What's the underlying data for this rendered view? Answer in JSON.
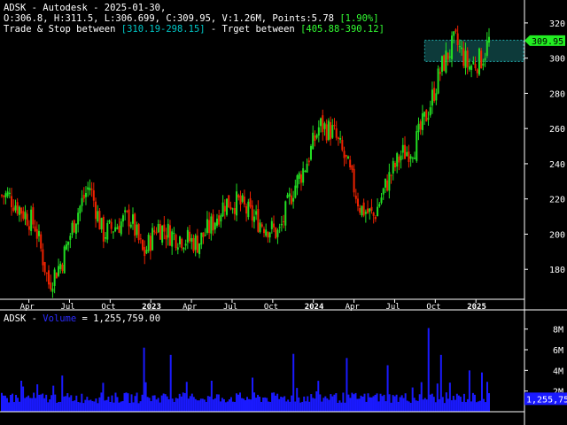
{
  "header": {
    "title": "ADSK - Autodesk - 2025-01-30,",
    "ohlc": "O:306.8, H:311.5, L:306.699, C:309.95, V:1.26M, Points:5.78",
    "change_pct": "[1.90%]",
    "line3_prefix": "Trade & Stop between ",
    "trade_stop_range": "[310.19-298.15]",
    "line3_mid": " - Trget between ",
    "target_range": "[405.88-390.12]"
  },
  "volume_header": {
    "symbol": "ADSK",
    "sep1": " - ",
    "label": "Volume",
    "sep2": " = ",
    "value": "1,255,759.00"
  },
  "colors": {
    "background": "#000000",
    "up_candle": "#22dd22",
    "down_candle": "#ee2200",
    "volume_bar": "#1a1aff",
    "zone_fill": "#0d3a3a",
    "zone_border": "#22aaaa",
    "price_tag": "#22ee22",
    "volume_tag": "#1a1aff",
    "axis": "#ffffff"
  },
  "chart_data": [
    {
      "type": "candlestick",
      "title": "ADSK - Autodesk - 2025-01-30",
      "y_ticks": [
        180,
        200,
        220,
        240,
        260,
        280,
        300,
        320
      ],
      "ylim": [
        163,
        328
      ],
      "x_ticks": [
        "Apr",
        "Jul",
        "Oct",
        "2023",
        "Apr",
        "Jul",
        "Oct",
        "2024",
        "Apr",
        "Jul",
        "Oct",
        "2025"
      ],
      "last_price_label": "309.95",
      "zone": {
        "low": 298.15,
        "high": 310.19
      },
      "approx_close_path": [
        {
          "t": "2022-02",
          "close": 222
        },
        {
          "t": "2022-04",
          "close": 205
        },
        {
          "t": "2022-05",
          "close": 172
        },
        {
          "t": "2022-06",
          "close": 185
        },
        {
          "t": "2022-07",
          "close": 210
        },
        {
          "t": "2022-08",
          "close": 228
        },
        {
          "t": "2022-09",
          "close": 200
        },
        {
          "t": "2022-10",
          "close": 205
        },
        {
          "t": "2022-11",
          "close": 210
        },
        {
          "t": "2022-12",
          "close": 188
        },
        {
          "t": "2023-01",
          "close": 205
        },
        {
          "t": "2023-02",
          "close": 200
        },
        {
          "t": "2023-04",
          "close": 195
        },
        {
          "t": "2023-05",
          "close": 205
        },
        {
          "t": "2023-06",
          "close": 218
        },
        {
          "t": "2023-07",
          "close": 218
        },
        {
          "t": "2023-08",
          "close": 210
        },
        {
          "t": "2023-09",
          "close": 205
        },
        {
          "t": "2023-10",
          "close": 200
        },
        {
          "t": "2023-11",
          "close": 225
        },
        {
          "t": "2023-12",
          "close": 240
        },
        {
          "t": "2024-01",
          "close": 262
        },
        {
          "t": "2024-02",
          "close": 258
        },
        {
          "t": "2024-03",
          "close": 240
        },
        {
          "t": "2024-04",
          "close": 215
        },
        {
          "t": "2024-05",
          "close": 210
        },
        {
          "t": "2024-06",
          "close": 230
        },
        {
          "t": "2024-07",
          "close": 245
        },
        {
          "t": "2024-08",
          "close": 250
        },
        {
          "t": "2024-09",
          "close": 270
        },
        {
          "t": "2024-10",
          "close": 295
        },
        {
          "t": "2024-11",
          "close": 310
        },
        {
          "t": "2024-12",
          "close": 295
        },
        {
          "t": "2025-01",
          "close": 300
        },
        {
          "t": "2025-01-30",
          "close": 309.95
        }
      ]
    },
    {
      "type": "bar",
      "title": "ADSK - Volume",
      "y_ticks": [
        "2M",
        "4M",
        "6M",
        "8M"
      ],
      "ylim": [
        0,
        9000000
      ],
      "last_value_label": "1,255,759",
      "typical_volume": 1500000,
      "spikes": [
        {
          "t": "2022-03",
          "value": 3000000
        },
        {
          "t": "2022-06",
          "value": 3500000
        },
        {
          "t": "2022-09",
          "value": 2800000
        },
        {
          "t": "2022-12",
          "value": 6200000
        },
        {
          "t": "2023-02",
          "value": 5500000
        },
        {
          "t": "2023-05",
          "value": 3000000
        },
        {
          "t": "2023-08",
          "value": 3300000
        },
        {
          "t": "2023-11",
          "value": 3500000
        },
        {
          "t": "2024-03",
          "value": 5200000
        },
        {
          "t": "2024-06",
          "value": 4500000
        },
        {
          "t": "2024-09",
          "value": 8100000
        },
        {
          "t": "2024-10",
          "value": 5500000
        },
        {
          "t": "2024-12",
          "value": 4000000
        },
        {
          "t": "2025-01",
          "value": 3800000
        }
      ]
    }
  ]
}
